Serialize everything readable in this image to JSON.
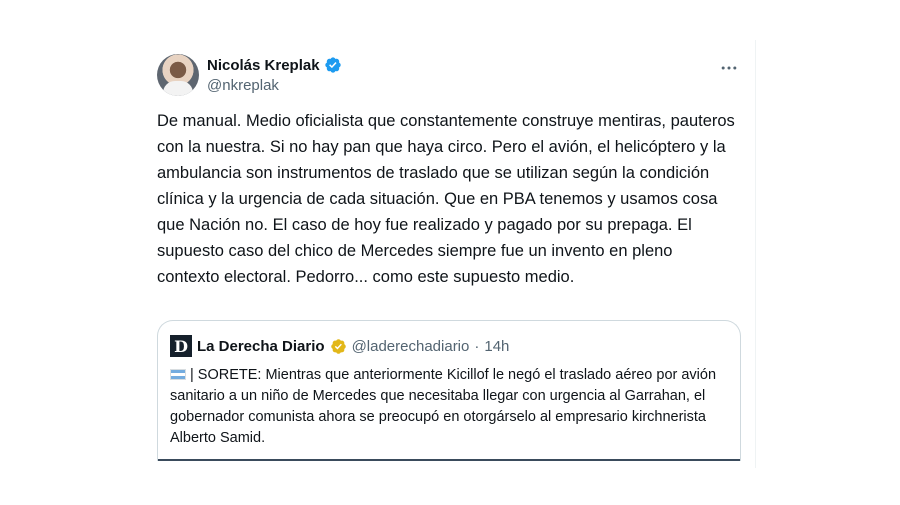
{
  "tweet": {
    "author_name": "Nicolás Kreplak",
    "author_handle": "@nkreplak",
    "text": "De manual. Medio oficialista que constantemente construye mentiras, pauteros con la nuestra. Si no hay pan que haya circo. Pero el avión, el helicóptero y la ambulancia son instrumentos de traslado que se utilizan según la condición clínica y la urgencia de cada situación. Que en PBA tenemos y usamos cosa que  Nación no. El caso de hoy fue realizado y pagado por su prepaga. El supuesto caso del chico de Mercedes siempre fue un invento en pleno contexto electoral. Pedorro... como este supuesto medio.",
    "verified_color": "#1d9bf0"
  },
  "quoted_tweet": {
    "avatar_letter": "D",
    "author_name": "La Derecha Diario",
    "author_handle": "@laderechadiario",
    "separator": "·",
    "time": "14h",
    "text": "| SORETE: Mientras que anteriormente Kicillof le negó el traslado aéreo por avión sanitario a un niño de Mercedes que necesitaba llegar con urgencia al Garrahan, el gobernador comunista ahora se preocupó en otorgárselo al empresario kirchnerista Alberto Samid.",
    "badge_color": "#e2b719",
    "flag_icon": "argentina-flag-icon"
  },
  "icons": {
    "more": "more-options-icon",
    "verified": "verified-badge-icon"
  }
}
